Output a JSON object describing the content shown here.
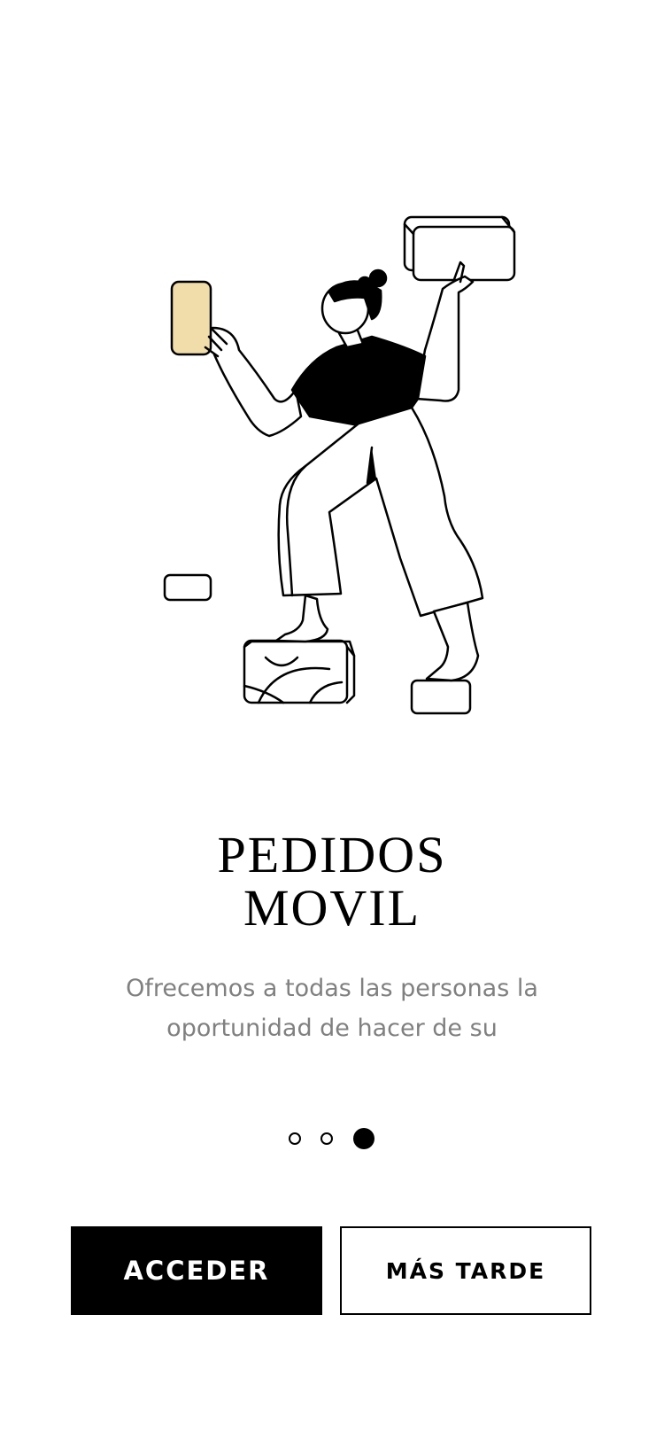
{
  "onboarding": {
    "title_line1": "PEDIDOS",
    "title_line2": "MOVIL",
    "description_line1": "Ofrecemos a todas las personas la",
    "description_line2": "oportunidad de hacer de su",
    "pagination": {
      "total": 3,
      "active": 3
    }
  },
  "actions": {
    "primary_label": "ACCEDER",
    "secondary_label": "MÁS TARDE"
  },
  "colors": {
    "accent": "#F1DDAA",
    "primary_button": "#000000",
    "text_muted": "#808080"
  },
  "icons": {
    "illustration": "person-stacking-blocks-illustration"
  }
}
